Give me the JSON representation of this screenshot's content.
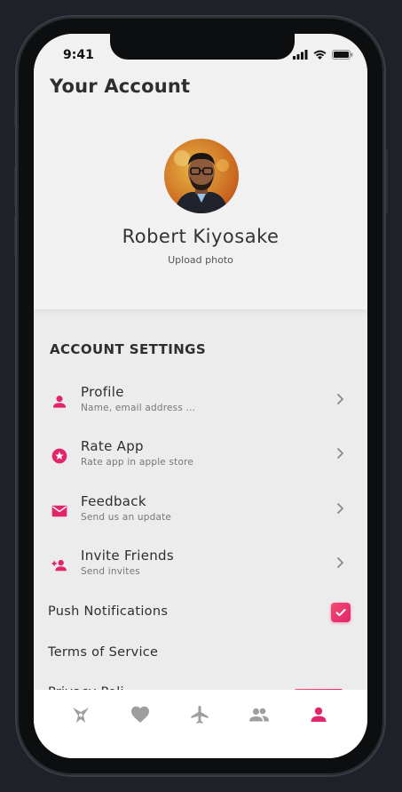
{
  "status": {
    "time": "9:41"
  },
  "header": {
    "title": "Your Account"
  },
  "profile": {
    "name": "Robert Kiyosake",
    "upload_label": "Upload photo"
  },
  "settings": {
    "section_title": "ACCOUNT SETTINGS",
    "items": [
      {
        "label": "Profile",
        "sub": "Name, email address ...",
        "icon": "person-icon"
      },
      {
        "label": "Rate App",
        "sub": "Rate app in apple store",
        "icon": "star-badge-icon"
      },
      {
        "label": "Feedback",
        "sub": "Send us an update",
        "icon": "mail-icon"
      },
      {
        "label": "Invite Friends",
        "sub": "Send invites",
        "icon": "person-add-icon"
      }
    ],
    "push_notifications": {
      "label": "Push Notifications",
      "checked": true
    },
    "terms_label": "Terms of Service",
    "privacy_label": "Privacy Poli"
  },
  "tabbar": {
    "tabs": [
      {
        "icon": "explore-icon",
        "active": false
      },
      {
        "icon": "heart-icon",
        "active": false
      },
      {
        "icon": "plane-icon",
        "active": false
      },
      {
        "icon": "people-icon",
        "active": false
      },
      {
        "icon": "person-icon",
        "active": true
      }
    ]
  },
  "colors": {
    "accent": "#e2256a",
    "inactive": "#9e9e9e"
  }
}
